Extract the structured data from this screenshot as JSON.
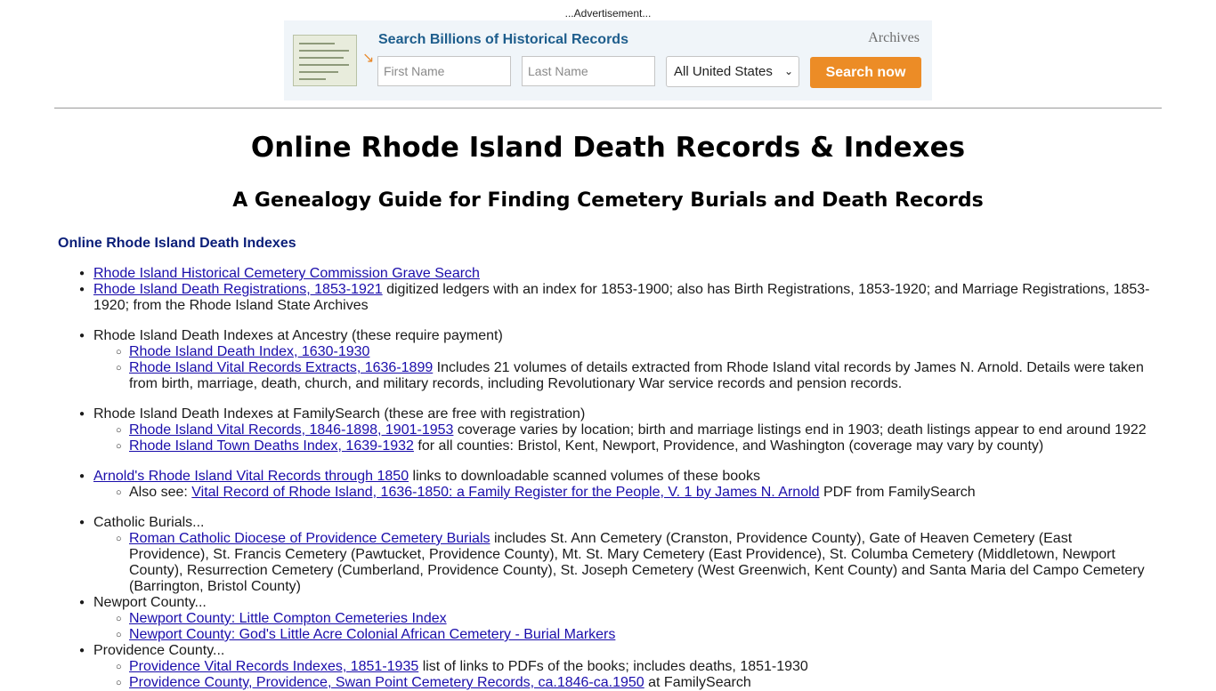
{
  "ad": {
    "label": "...Advertisement...",
    "title": "Search Billions of Historical Records",
    "brand": "Archives",
    "first_name_placeholder": "First Name",
    "last_name_placeholder": "Last Name",
    "location_selected": "All United States",
    "search_button": "Search now",
    "accent_color": "#ec8c26",
    "title_color": "#1d5d8c"
  },
  "page": {
    "title": "Online Rhode Island Death Records & Indexes",
    "subtitle": "A Genealogy Guide for Finding Cemetery Burials and Death Records",
    "section_heading": "Online Rhode Island Death Indexes"
  },
  "items": {
    "i1": {
      "link": "Rhode Island Historical Cemetery Commission Grave Search"
    },
    "i2": {
      "link": "Rhode Island Death Registrations, 1853-1921",
      "text": " digitized ledgers with an index for 1853-1900; also has Birth Registrations, 1853-1920; and Marriage Registrations, 1853-1920; from the Rhode Island State Archives"
    },
    "ancestry": {
      "text": "Rhode Island Death Indexes at Ancestry (these require payment)",
      "sub1_link": "Rhode Island Death Index, 1630-1930",
      "sub2_link": "Rhode Island Vital Records Extracts, 1636-1899",
      "sub2_text": " Includes 21 volumes of details extracted from Rhode Island vital records by James N. Arnold. Details were taken from birth, marriage, death, church, and military records, including Revolutionary War service records and pension records."
    },
    "familysearch": {
      "text": "Rhode Island Death Indexes at FamilySearch (these are free with registration)",
      "sub1_link": "Rhode Island Vital Records, 1846-1898, 1901-1953",
      "sub1_text": " coverage varies by location; birth and marriage listings end in 1903; death listings appear to end around 1922",
      "sub2_link": "Rhode Island Town Deaths Index, 1639-1932",
      "sub2_text": " for all counties: Bristol, Kent, Newport, Providence, and Washington (coverage may vary by county)"
    },
    "arnold": {
      "link": "Arnold's Rhode Island Vital Records through 1850",
      "text": " links to downloadable scanned volumes of these books",
      "sub_prefix": "Also see: ",
      "sub_link": "Vital Record of Rhode Island, 1636-1850: a Family Register for the People, V. 1 by James N. Arnold",
      "sub_text": " PDF from FamilySearch"
    },
    "catholic": {
      "text": "Catholic Burials...",
      "sub_link": "Roman Catholic Diocese of Providence Cemetery Burials",
      "sub_text": " includes St. Ann Cemetery (Cranston, Providence County), Gate of Heaven Cemetery (East Providence), St. Francis Cemetery (Pawtucket, Providence County), Mt. St. Mary Cemetery (East Providence), St. Columba Cemetery (Middletown, Newport County), Resurrection Cemetery (Cumberland, Providence County), St. Joseph Cemetery (West Greenwich, Kent County) and Santa Maria del Campo Cemetery (Barrington, Bristol County)"
    },
    "newport": {
      "text": "Newport County...",
      "sub1_link": "Newport County: Little Compton Cemeteries Index",
      "sub2_link": "Newport County: God's Little Acre Colonial African Cemetery - Burial Markers"
    },
    "providence": {
      "text": "Providence County...",
      "sub1_link": "Providence Vital Records Indexes, 1851-1935",
      "sub1_text": " list of links to PDFs of the books; includes deaths, 1851-1930",
      "sub2_link": "Providence County, Providence, Swan Point Cemetery Records, ca.1846-ca.1950",
      "sub2_text": " at FamilySearch"
    }
  }
}
